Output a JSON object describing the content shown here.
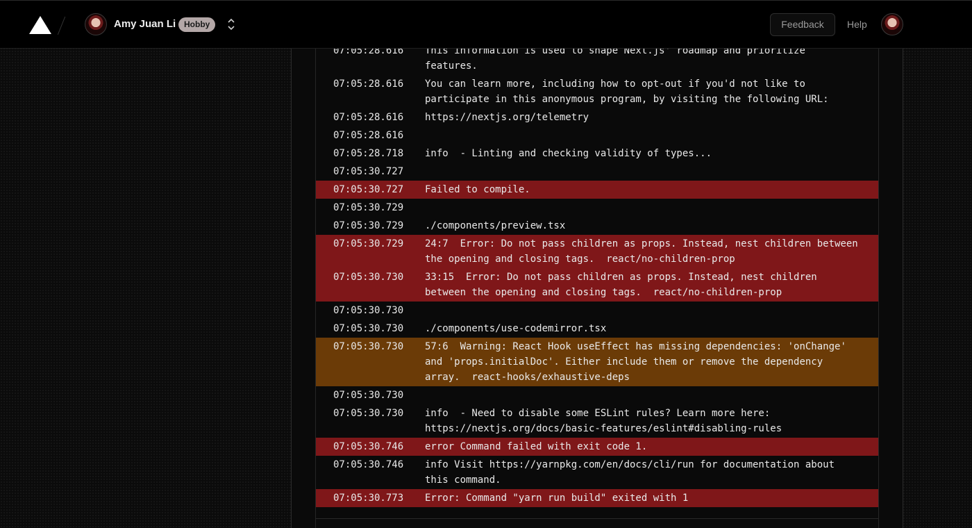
{
  "header": {
    "user_name": "Amy Juan Li",
    "plan_badge": "Hobby",
    "feedback_label": "Feedback",
    "help_label": "Help"
  },
  "colors": {
    "error_row": "#7f1719",
    "warning_row": "#6b3b07",
    "background": "#0b0b0b"
  },
  "log": [
    {
      "ts": "07:05:28.616",
      "msg": "This information is used to shape Next.js' roadmap and prioritize features.",
      "level": "info"
    },
    {
      "ts": "07:05:28.616",
      "msg": "You can learn more, including how to opt-out if you'd not like to participate in this anonymous program, by visiting the following URL:",
      "level": "info"
    },
    {
      "ts": "07:05:28.616",
      "msg": "https://nextjs.org/telemetry",
      "level": "info"
    },
    {
      "ts": "07:05:28.616",
      "msg": "",
      "level": "info"
    },
    {
      "ts": "07:05:28.718",
      "msg": "info  - Linting and checking validity of types...",
      "level": "info"
    },
    {
      "ts": "07:05:30.727",
      "msg": "",
      "level": "info"
    },
    {
      "ts": "07:05:30.727",
      "msg": "Failed to compile.",
      "level": "error"
    },
    {
      "ts": "07:05:30.729",
      "msg": "",
      "level": "info"
    },
    {
      "ts": "07:05:30.729",
      "msg": "./components/preview.tsx",
      "level": "info"
    },
    {
      "ts": "07:05:30.729",
      "msg": "24:7  Error: Do not pass children as props. Instead, nest children between the opening and closing tags.  react/no-children-prop",
      "level": "error"
    },
    {
      "ts": "07:05:30.730",
      "msg": "33:15  Error: Do not pass children as props. Instead, nest children between the opening and closing tags.  react/no-children-prop",
      "level": "error"
    },
    {
      "ts": "07:05:30.730",
      "msg": "",
      "level": "info"
    },
    {
      "ts": "07:05:30.730",
      "msg": "./components/use-codemirror.tsx",
      "level": "info"
    },
    {
      "ts": "07:05:30.730",
      "msg": "57:6  Warning: React Hook useEffect has missing dependencies: 'onChange' and 'props.initialDoc'. Either include them or remove the dependency array.  react-hooks/exhaustive-deps",
      "level": "warning"
    },
    {
      "ts": "07:05:30.730",
      "msg": "",
      "level": "info"
    },
    {
      "ts": "07:05:30.730",
      "msg": "info  - Need to disable some ESLint rules? Learn more here: https://nextjs.org/docs/basic-features/eslint#disabling-rules",
      "level": "info"
    },
    {
      "ts": "07:05:30.746",
      "msg": "error Command failed with exit code 1.",
      "level": "error"
    },
    {
      "ts": "07:05:30.746",
      "msg": "info Visit https://yarnpkg.com/en/docs/cli/run for documentation about this command.",
      "level": "info"
    },
    {
      "ts": "07:05:30.773",
      "msg": "Error: Command \"yarn run build\" exited with 1",
      "level": "error"
    }
  ]
}
